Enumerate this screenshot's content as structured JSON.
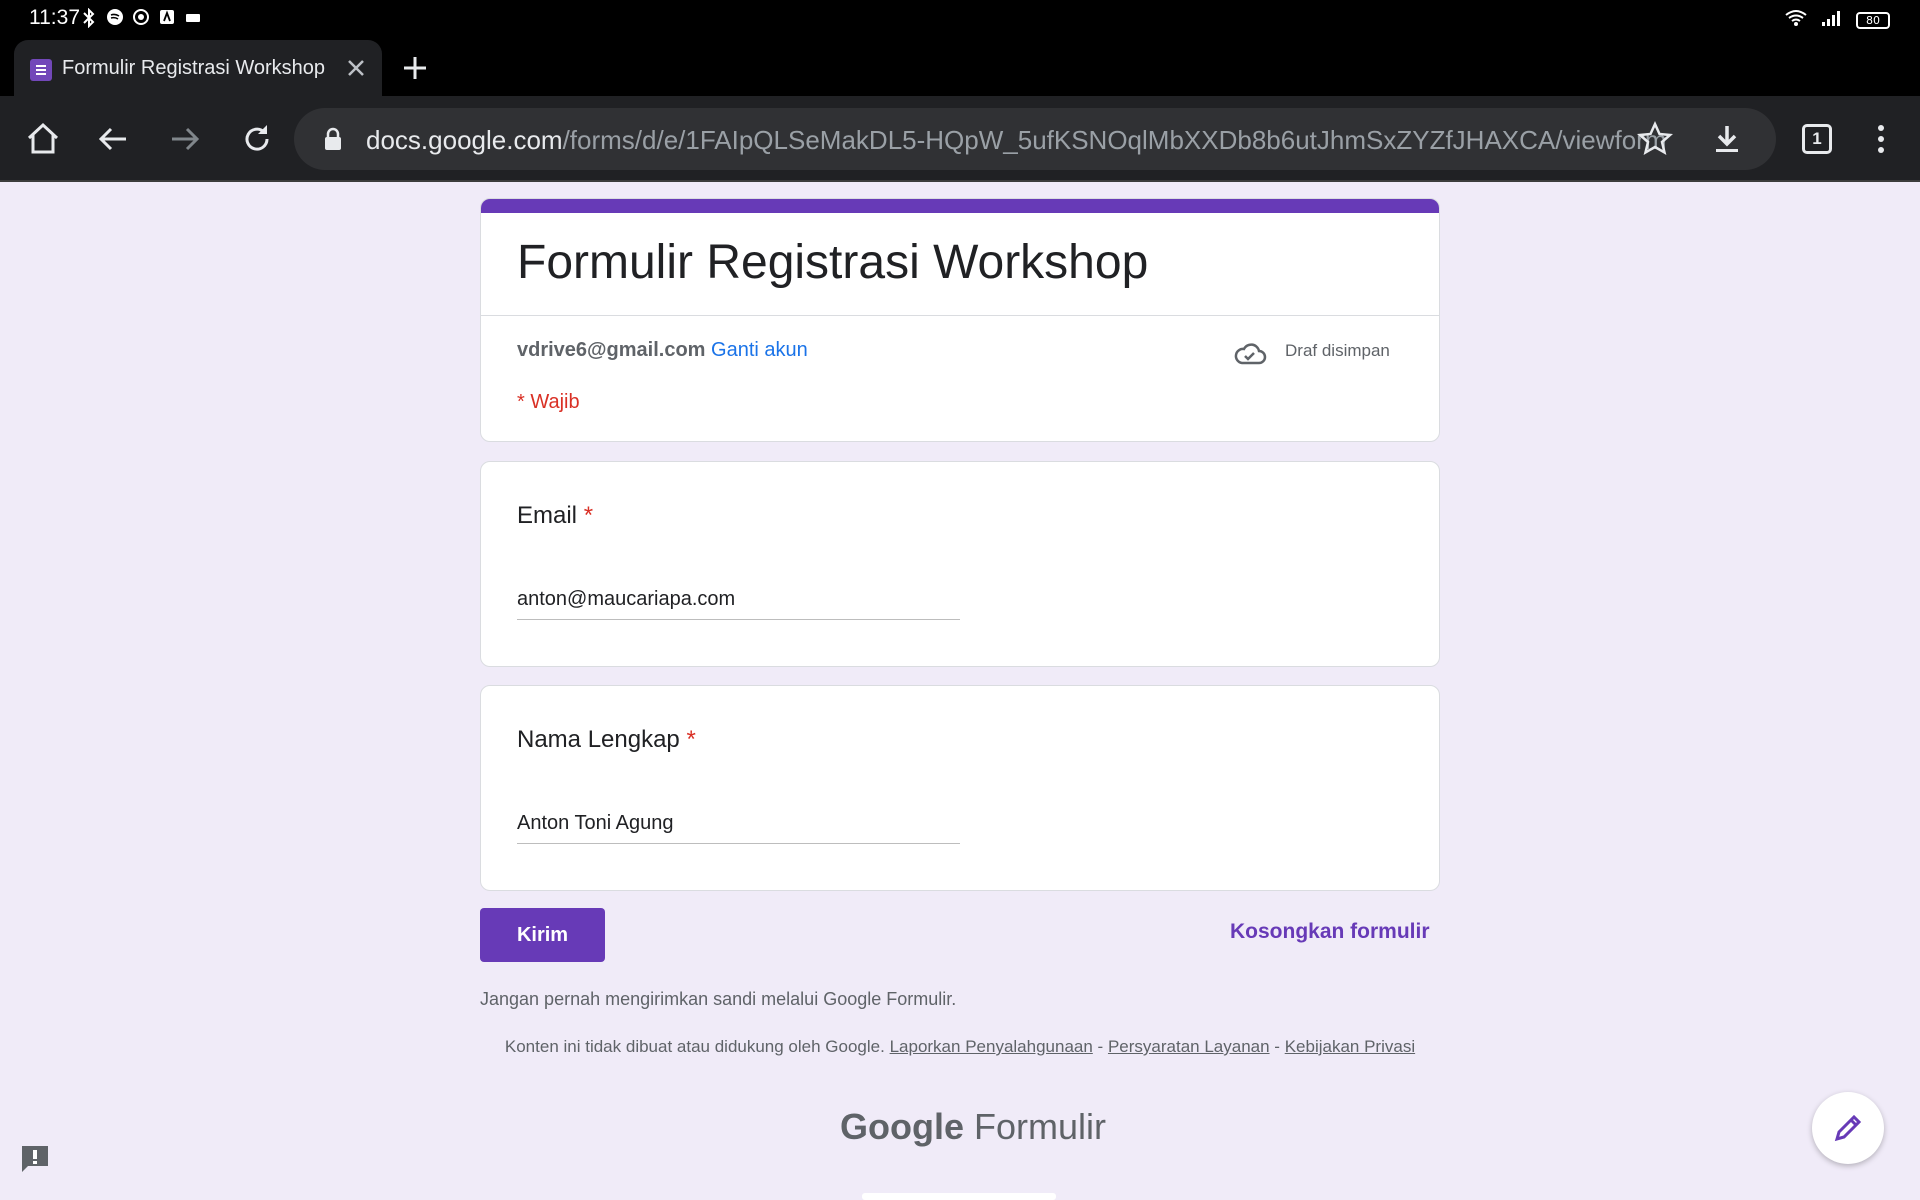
{
  "status_bar": {
    "time": "11:37",
    "battery": "80"
  },
  "tab": {
    "title": "Formulir Registrasi Workshop"
  },
  "url": {
    "host": "docs.google.com",
    "path": "/forms/d/e/1FAIpQLSeMakDL5-HQpW_5ufKSNOqlMbXXDb8b6utJhmSxZYZfJHAXCA/viewform"
  },
  "tab_count": "1",
  "form": {
    "title": "Formulir Registrasi Workshop",
    "account_email": "vdrive6@gmail.com",
    "switch_account": "Ganti akun",
    "draft_status": "Draf disimpan",
    "required_note": "* Wajib",
    "questions": [
      {
        "label": "Email",
        "required_mark": "*",
        "value": "anton@maucariapa.com"
      },
      {
        "label": "Nama Lengkap",
        "required_mark": "*",
        "value": "Anton Toni Agung"
      }
    ],
    "submit_label": "Kirim",
    "clear_label": "Kosongkan formulir",
    "password_note": "Jangan pernah mengirimkan sandi melalui Google Formulir.",
    "disclaimer_text": "Konten ini tidak dibuat atau didukung oleh Google.",
    "report_abuse": "Laporkan Penyalahgunaan",
    "terms": "Persyaratan Layanan",
    "privacy": "Kebijakan Privasi",
    "separator": "-",
    "brand_google": "Google",
    "brand_product": "Formulir"
  },
  "colors": {
    "accent": "#673ab7",
    "required": "#d93025",
    "link": "#1a73e8",
    "background": "#f0ebf8"
  }
}
